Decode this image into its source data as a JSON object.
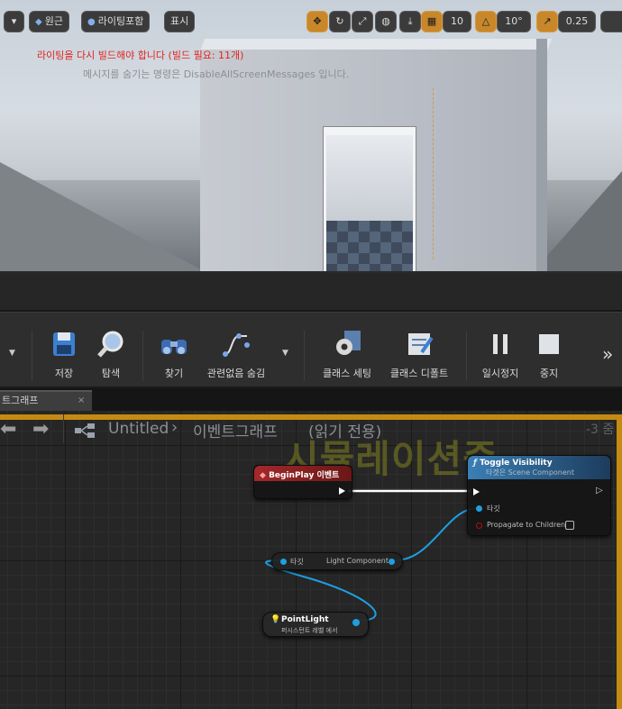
{
  "viewport": {
    "toolbar": {
      "perspective_label": "원근",
      "lit_label": "라이팅포함",
      "show_label": "표시",
      "grid_snap_value": "10",
      "rotation_snap_value": "10°",
      "scale_snap_value": "0.25"
    },
    "messages": {
      "lighting_rebuild": "라이팅을 다시 빌드해야 합니다 (빌드 필요: 11개)",
      "hide_hint": "메시지를 숨기는 명령은 DisableAllScreenMessages 입니다."
    },
    "colors": {
      "active_button": "#c7872a",
      "error_text": "#e0221c"
    }
  },
  "blueprint_toolbar": {
    "items": [
      {
        "label": "저장",
        "icon": "save-icon"
      },
      {
        "label": "탐색",
        "icon": "browse-icon"
      },
      {
        "label": "찾기",
        "icon": "find-icon"
      },
      {
        "label": "관련없음 숨김",
        "icon": "hide-unrelated-icon"
      },
      {
        "label": "클래스 세팅",
        "icon": "class-settings-icon"
      },
      {
        "label": "클래스 디폴트",
        "icon": "class-defaults-icon"
      },
      {
        "label": "일시정지",
        "icon": "pause-icon"
      },
      {
        "label": "중지",
        "icon": "stop-icon"
      }
    ],
    "overflow_icon": "chevron-double-right-icon"
  },
  "tab": {
    "label": "트그래프",
    "close": "×"
  },
  "graph": {
    "breadcrumb": {
      "root": "Untitled",
      "separator": "›",
      "graph_name": "이벤트그래프",
      "readonly": "(읽기 전용)",
      "zoom": "-3 줌"
    },
    "watermark": "시뮬레이션중",
    "nodes": {
      "begin_play": {
        "title": "BeginPlay 이벤트"
      },
      "toggle_visibility": {
        "title": "Toggle Visibility",
        "subtitle": "타겟은 Scene Component",
        "pin_target": "타깃",
        "pin_propagate": "Propagate to Children"
      },
      "light_component_getter": {
        "pin_target": "타깃",
        "pin_output": "Light Component"
      },
      "point_light": {
        "title": "PointLight",
        "subtitle": "퍼시스턴트 레벨 에서"
      }
    },
    "colors": {
      "simulating_border": "#c48a12",
      "exec_wire": "#ffffff",
      "object_wire": "#1e9fe0"
    }
  }
}
